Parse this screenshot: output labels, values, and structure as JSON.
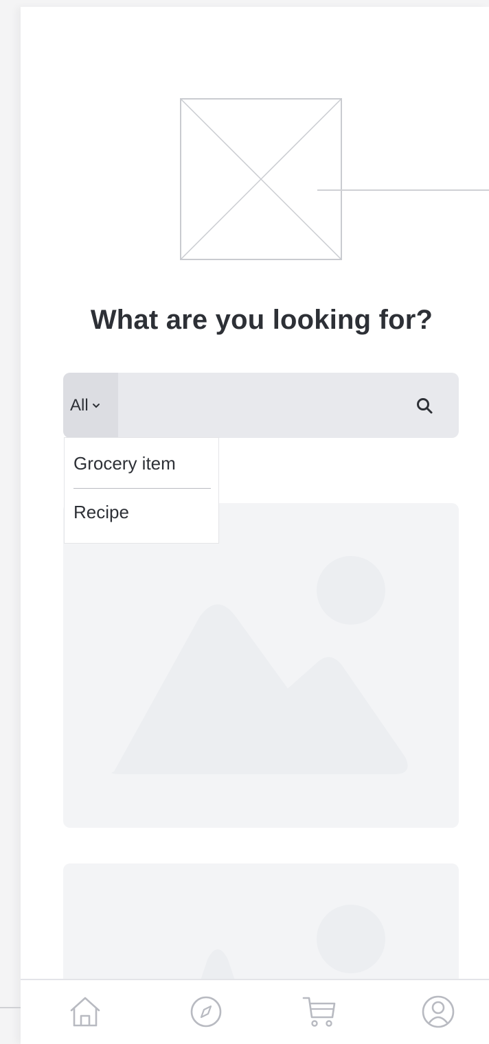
{
  "search": {
    "title": "What are you looking for?",
    "category_selected": "All",
    "placeholder": "",
    "dropdown_options": [
      "Grocery item",
      "Recipe"
    ]
  },
  "icons": {
    "logo": "image-placeholder-icon",
    "category_chevron": "chevron-down-icon",
    "search": "search-icon",
    "cards": "image-placeholder-icon"
  },
  "bottom_nav": {
    "items": [
      {
        "name": "home",
        "icon": "home-icon"
      },
      {
        "name": "explore",
        "icon": "compass-icon"
      },
      {
        "name": "cart",
        "icon": "cart-icon"
      },
      {
        "name": "profile",
        "icon": "user-icon"
      }
    ]
  },
  "colors": {
    "text": "#2d3036",
    "search_bg": "#e8e9ed",
    "card_bg": "#f3f4f6",
    "placeholder_shape": "#eceef1",
    "icon_stroke": "#b8bac1"
  }
}
